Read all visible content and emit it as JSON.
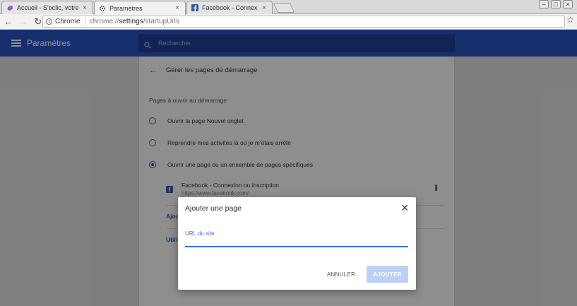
{
  "browser": {
    "tabs": [
      {
        "title": "Accueil - S'oclic, votre as",
        "icon": "eggplant-icon",
        "active": false
      },
      {
        "title": "Paramètres",
        "icon": "gear-icon",
        "active": true
      },
      {
        "title": "Facebook - Connexion ou",
        "icon": "facebook-icon",
        "active": false
      }
    ],
    "close_glyph": "×",
    "omnibox": {
      "chip": "Chrome",
      "url_scheme": "chrome://",
      "url_path": "settings",
      "url_rest": "/startupUrls"
    }
  },
  "settings": {
    "header_title": "Paramètres",
    "search_placeholder": "Rechercher",
    "card": {
      "title": "Gérer les pages de démarrage",
      "section_label": "Pages à ouvrir au démarrage",
      "options": [
        {
          "label": "Ouvrir la page Nouvel onglet",
          "checked": false
        },
        {
          "label": "Reprendre mes activités là où je m'étais arrêté",
          "checked": false
        },
        {
          "label": "Ouvrir une page ou un ensemble de pages spécifiques",
          "checked": true
        }
      ],
      "page_entry": {
        "title": "Facebook - Connexion ou inscription",
        "url": "https://www.facebook.com/"
      },
      "link_add": "Ajou",
      "link_use": "Utili"
    }
  },
  "dialog": {
    "title": "Ajouter une page",
    "field_label": "URL du site",
    "field_value": "",
    "cancel_label": "ANNULER",
    "add_label": "AJOUTER"
  },
  "colors": {
    "header_blue": "#2a52be",
    "accent_blue": "#3e6dd9",
    "add_button_disabled": "#bcd0f5"
  }
}
